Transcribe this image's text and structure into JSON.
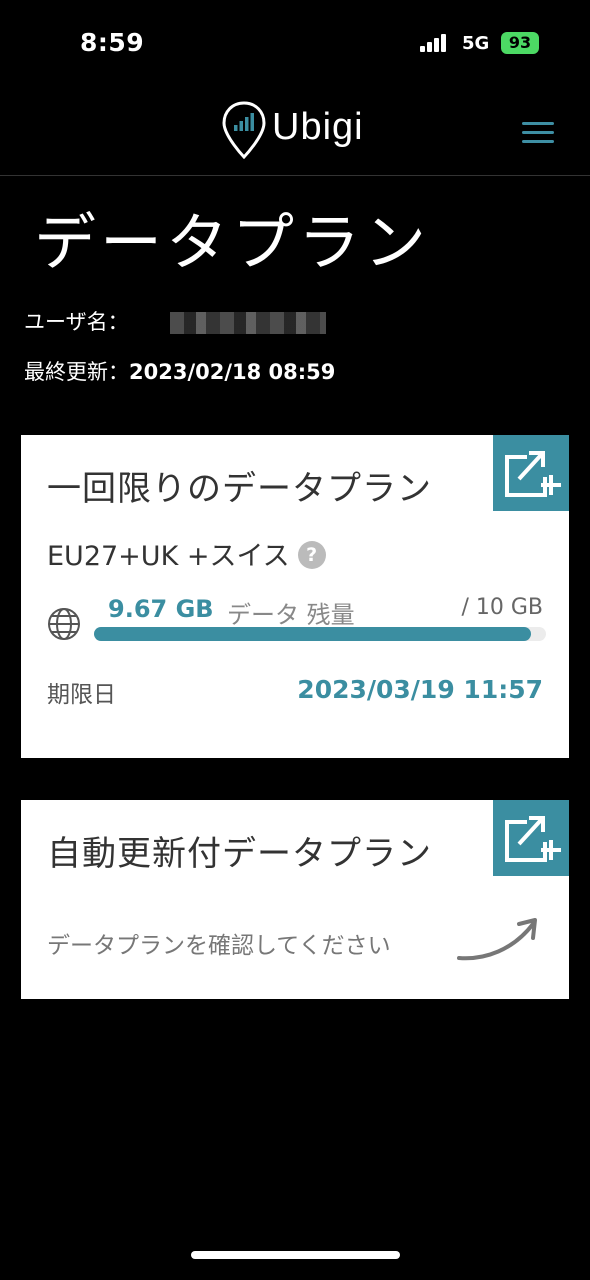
{
  "status_bar": {
    "time": "8:59",
    "network": "5G",
    "battery": "93"
  },
  "header": {
    "logo_text": "Ubigi",
    "icons": [
      "location-pin-signal-logo",
      "hamburger-menu-icon"
    ],
    "accent_color": "#3b8ea1"
  },
  "page": {
    "title": "データプラン",
    "username_label": "ユーザ名：",
    "last_updated_label": "最終更新：",
    "last_updated_value": "2023/02/18 08:59"
  },
  "one_time_plan": {
    "title": "一回限りのデータプラン",
    "plan_name": "EU27+UK +スイス",
    "help_icon": "?",
    "data_remaining": "9.67 GB",
    "data_remaining_label": "データ 残量",
    "data_total": "/ 10 GB",
    "remaining_fraction": 0.967,
    "expiry_label": "期限日",
    "expiry_date": "2023/03/19 11:57"
  },
  "auto_renew_plan": {
    "title": "自動更新付データプラン",
    "confirm_text": "データプランを確認してください"
  }
}
